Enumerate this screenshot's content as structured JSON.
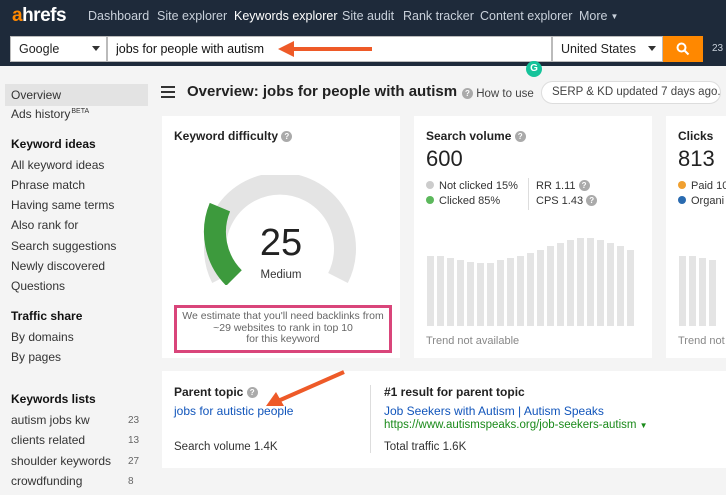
{
  "brand": {
    "logo_a": "a",
    "logo_rest": "hrefs"
  },
  "nav": {
    "items": [
      {
        "label": "Dashboard"
      },
      {
        "label": "Site explorer"
      },
      {
        "label": "Keywords explorer"
      },
      {
        "label": "Site audit"
      },
      {
        "label": "Rank tracker"
      },
      {
        "label": "Content explorer"
      },
      {
        "label": "More"
      }
    ],
    "active_index": 2
  },
  "search": {
    "engine": "Google",
    "query": "jobs for people with autism",
    "country": "United States",
    "truncated_count": "23"
  },
  "sidebar": {
    "top": [
      {
        "label": "Overview"
      },
      {
        "label": "Ads history",
        "badge": "BETA"
      }
    ],
    "keyword_ideas_title": "Keyword ideas",
    "keyword_ideas": [
      {
        "label": "All keyword ideas"
      },
      {
        "label": "Phrase match"
      },
      {
        "label": "Having same terms"
      },
      {
        "label": "Also rank for"
      },
      {
        "label": "Search suggestions"
      },
      {
        "label": "Newly discovered"
      },
      {
        "label": "Questions"
      }
    ],
    "traffic_share_title": "Traffic share",
    "traffic_share": [
      {
        "label": "By domains"
      },
      {
        "label": "By pages"
      }
    ],
    "keyword_lists_title": "Keywords lists",
    "keyword_lists": [
      {
        "label": "autism jobs kw",
        "count": "23"
      },
      {
        "label": "clients related",
        "count": "13"
      },
      {
        "label": "shoulder keywords",
        "count": "27"
      },
      {
        "label": "crowdfunding",
        "count": "8"
      }
    ]
  },
  "header": {
    "title": "Overview: jobs for people with autism",
    "how_to_use": "How to use",
    "serp_status": "SERP & KD updated 7 days ago."
  },
  "kd_card": {
    "title": "Keyword difficulty",
    "score": "25",
    "score_value": 25,
    "difficulty_label": "Medium",
    "estimate_line1": "We estimate that you'll need backlinks from",
    "estimate_line2": "~29 websites to rank in top 10",
    "estimate_line3": "for this keyword"
  },
  "volume_card": {
    "title": "Search volume",
    "value": "600",
    "not_clicked": "Not clicked 15%",
    "clicked": "Clicked 85%",
    "rr": "RR 1.11",
    "cps": "CPS 1.43",
    "trend_note": "Trend not available"
  },
  "clicks_card": {
    "title": "Clicks",
    "value": "813",
    "paid": "Paid 10",
    "organic": "Organi",
    "trend_note": "Trend not"
  },
  "parent_topic": {
    "title": "Parent topic",
    "link": "jobs for autistic people",
    "volume": "Search volume 1.4K",
    "result_title": "#1 result for parent topic",
    "result_link": "Job Seekers with Autism | Autism Speaks",
    "result_url": "https://www.autismspeaks.org/job-seekers-autism",
    "total_traffic": "Total traffic 1.6K"
  },
  "colors": {
    "nav_bg": "#1e2a3a",
    "accent": "#ff8800",
    "link": "#1155bb",
    "url_green": "#1a8a1a",
    "kd_green": "#3d9a3d",
    "highlight_box": "#d9457a",
    "annotation_arrow": "#ee5a28",
    "not_clicked_dot": "#cccccc",
    "clicked_dot": "#5cb85c",
    "paid_dot": "#f0a030",
    "organic_dot": "#2a6bb0"
  },
  "icons": {
    "search": "magnifier-icon",
    "help": "question-circle-icon",
    "menu": "hamburger-icon",
    "grammarly": "grammarly-icon",
    "annotation": "red-arrow"
  },
  "trend_bars": [
    0.7,
    0.7,
    0.68,
    0.66,
    0.64,
    0.63,
    0.63,
    0.66,
    0.68,
    0.7,
    0.73,
    0.76,
    0.8,
    0.83,
    0.86,
    0.88,
    0.88,
    0.86,
    0.83,
    0.8,
    0.76
  ]
}
